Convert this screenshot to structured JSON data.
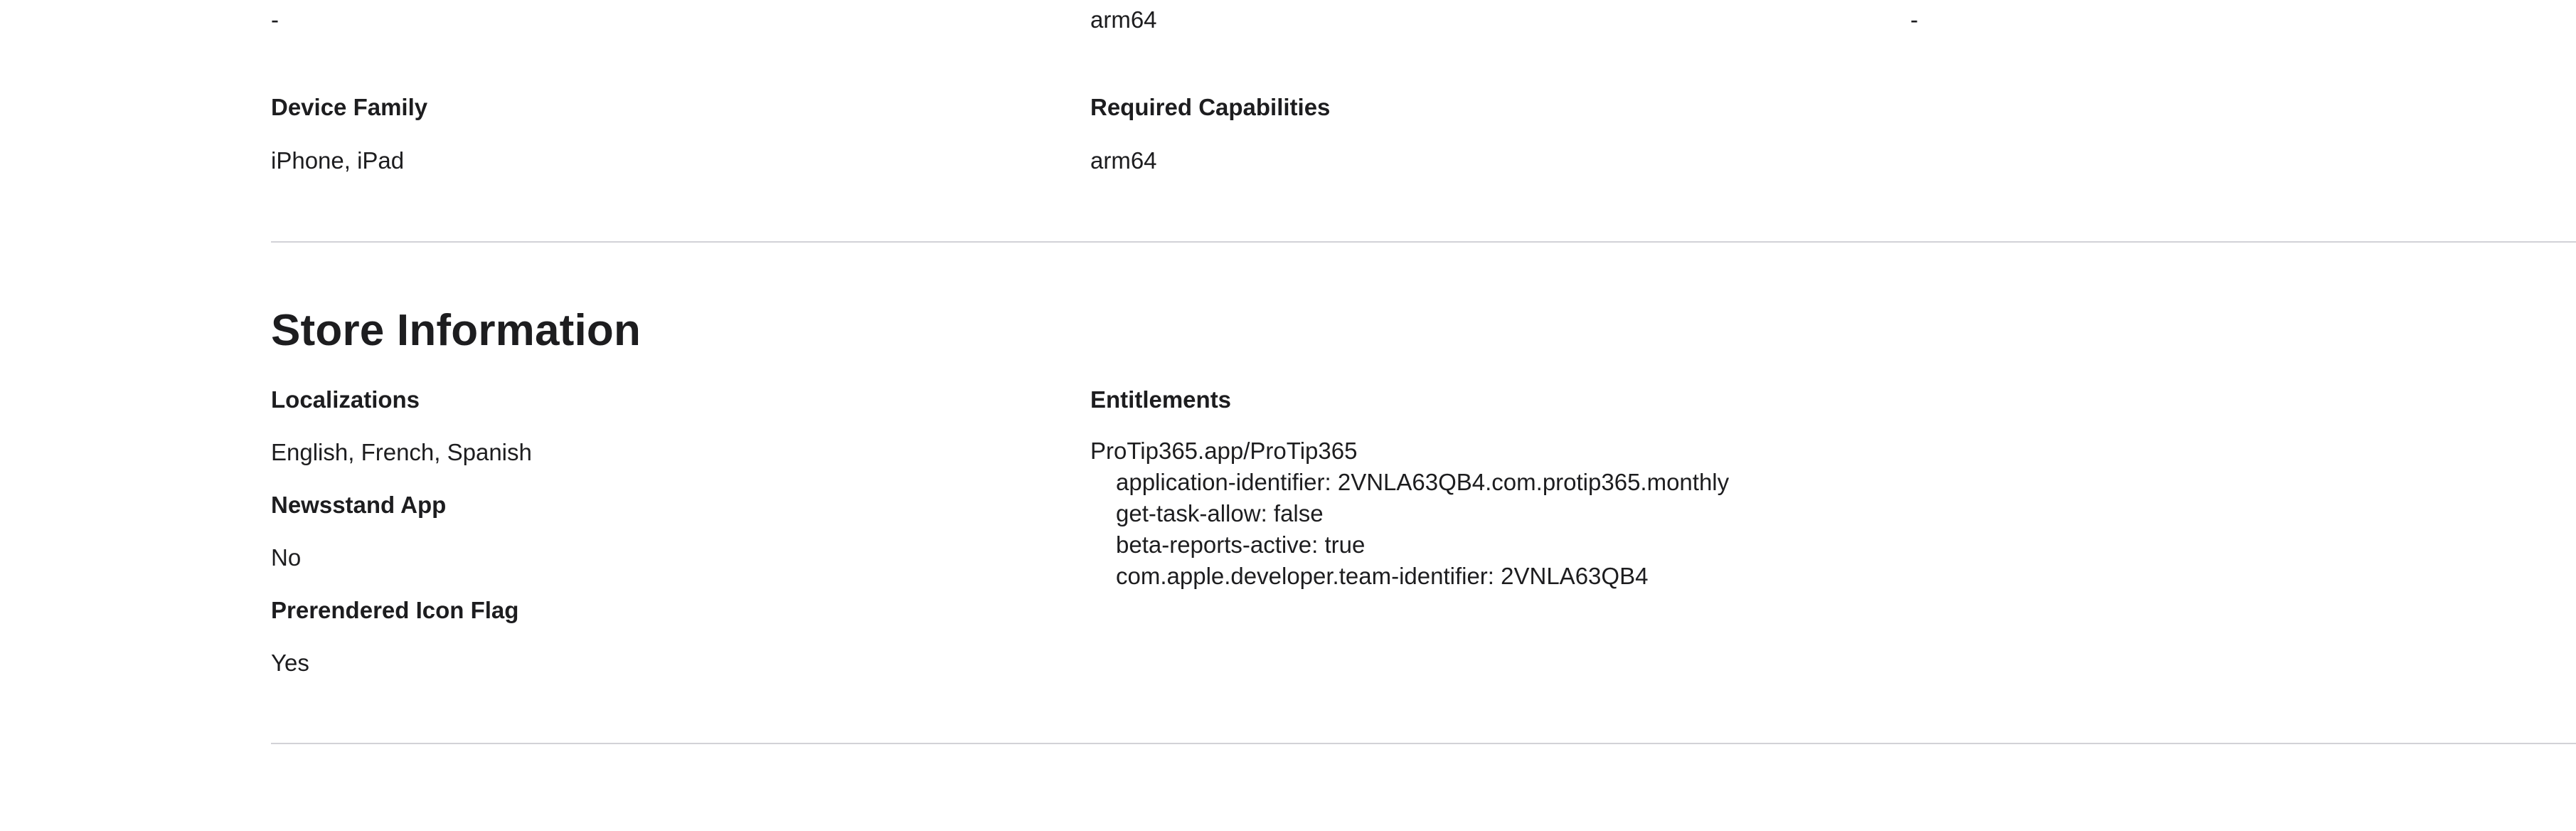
{
  "top_row": {
    "col1": "-",
    "col2": "arm64",
    "col3": "-"
  },
  "compatibility": {
    "device_family_label": "Device Family",
    "device_family_value": "iPhone, iPad",
    "required_capabilities_label": "Required Capabilities",
    "required_capabilities_value": "arm64"
  },
  "store_information": {
    "title": "Store Information",
    "localizations_label": "Localizations",
    "localizations_value": "English, French, Spanish",
    "newsstand_label": "Newsstand App",
    "newsstand_value": "No",
    "prerendered_label": "Prerendered Icon Flag",
    "prerendered_value": "Yes",
    "entitlements_label": "Entitlements",
    "entitlements_app": "ProTip365.app/ProTip365",
    "entitlements_items": [
      "application-identifier: 2VNLA63QB4.com.protip365.monthly",
      "get-task-allow: false",
      "beta-reports-active: true",
      "com.apple.developer.team-identifier: 2VNLA63QB4"
    ]
  }
}
